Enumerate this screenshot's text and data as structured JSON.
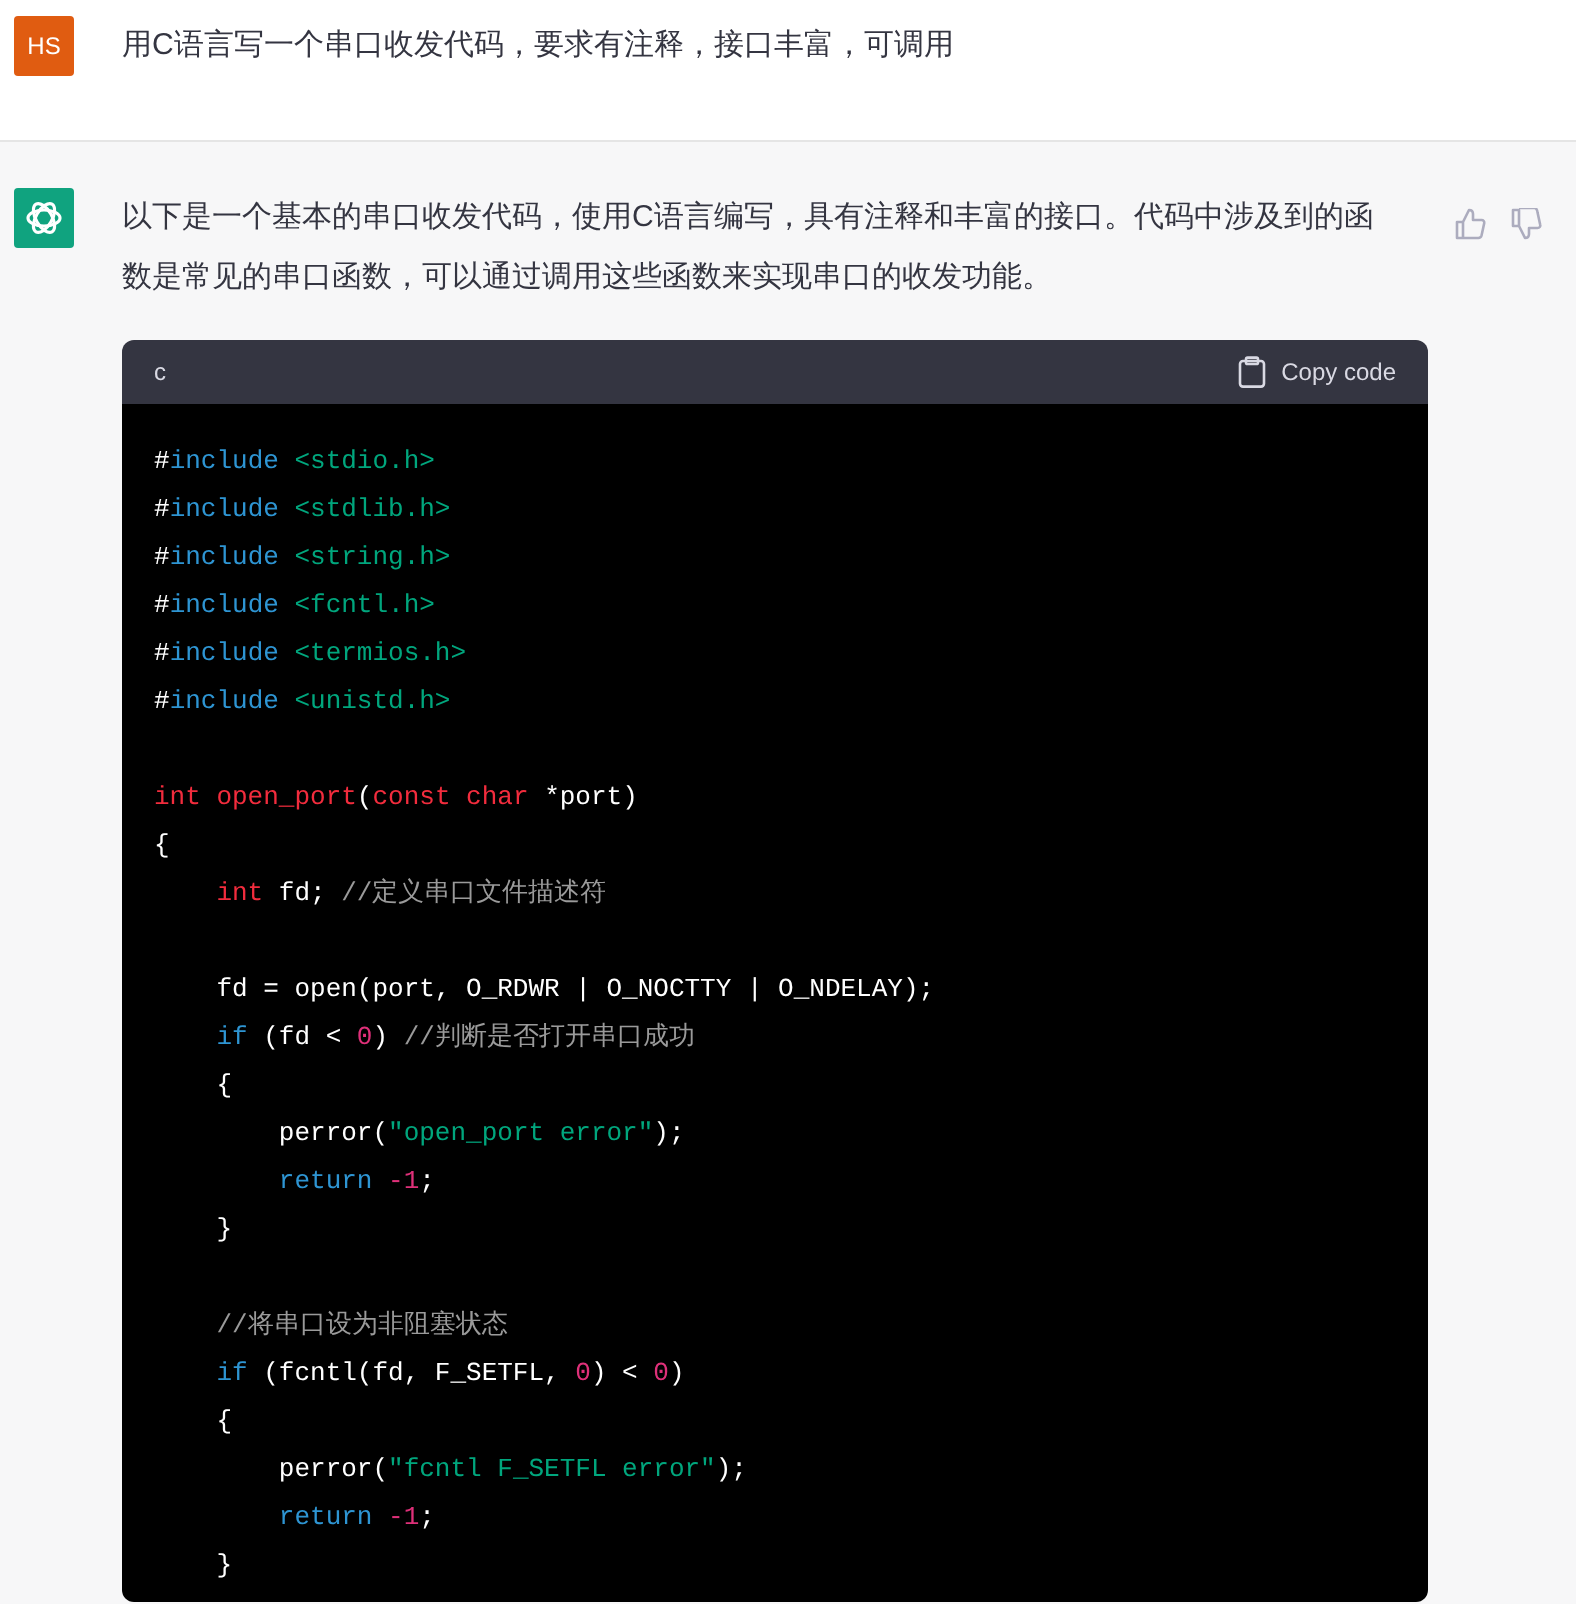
{
  "user_message": {
    "avatar": "HS",
    "text": "用C语言写一个串口收发代码，要求有注释，接口丰富，可调用"
  },
  "assistant_message": {
    "text": "以下是一个基本的串口收发代码，使用C语言编写，具有注释和丰富的接口。代码中涉及到的函数是常见的串口函数，可以通过调用这些函数来实现串口的收发功能。",
    "code_block": {
      "language": "c",
      "copy_label": "Copy code",
      "lines": [
        {
          "kind": "code",
          "tokens": [
            {
              "kind": "plain",
              "text": "#"
            },
            {
              "kind": "keyword",
              "text": "include"
            },
            {
              "kind": "string",
              "text": " <stdio.h>"
            }
          ]
        },
        {
          "kind": "code",
          "tokens": [
            {
              "kind": "plain",
              "text": "#"
            },
            {
              "kind": "keyword",
              "text": "include"
            },
            {
              "kind": "string",
              "text": " <stdlib.h>"
            }
          ]
        },
        {
          "kind": "code",
          "tokens": [
            {
              "kind": "plain",
              "text": "#"
            },
            {
              "kind": "keyword",
              "text": "include"
            },
            {
              "kind": "string",
              "text": " <string.h>"
            }
          ]
        },
        {
          "kind": "code",
          "tokens": [
            {
              "kind": "plain",
              "text": "#"
            },
            {
              "kind": "keyword",
              "text": "include"
            },
            {
              "kind": "string",
              "text": " <fcntl.h>"
            }
          ]
        },
        {
          "kind": "code",
          "tokens": [
            {
              "kind": "plain",
              "text": "#"
            },
            {
              "kind": "keyword",
              "text": "include"
            },
            {
              "kind": "string",
              "text": " <termios.h>"
            }
          ]
        },
        {
          "kind": "code",
          "tokens": [
            {
              "kind": "plain",
              "text": "#"
            },
            {
              "kind": "keyword",
              "text": "include"
            },
            {
              "kind": "string",
              "text": " <unistd.h>"
            }
          ]
        },
        {
          "kind": "blank"
        },
        {
          "kind": "code",
          "tokens": [
            {
              "kind": "type",
              "text": "int"
            },
            {
              "kind": "type",
              "text": " open_port"
            },
            {
              "kind": "plain",
              "text": "("
            },
            {
              "kind": "type",
              "text": "const"
            },
            {
              "kind": "type",
              "text": " char"
            },
            {
              "kind": "plain",
              "text": " *port)"
            }
          ]
        },
        {
          "kind": "code",
          "tokens": [
            {
              "kind": "plain",
              "text": "{"
            }
          ]
        },
        {
          "kind": "code",
          "tokens": [
            {
              "kind": "type",
              "text": "    int"
            },
            {
              "kind": "plain",
              "text": " fd; "
            },
            {
              "kind": "comment",
              "text": "//定义串口文件描述符"
            }
          ]
        },
        {
          "kind": "blank"
        },
        {
          "kind": "code",
          "tokens": [
            {
              "kind": "plain",
              "text": "    fd = open(port, O_RDWR | O_NOCTTY | O_NDELAY);"
            }
          ]
        },
        {
          "kind": "code",
          "tokens": [
            {
              "kind": "keyword",
              "text": "    if"
            },
            {
              "kind": "plain",
              "text": " (fd < "
            },
            {
              "kind": "number",
              "text": "0"
            },
            {
              "kind": "plain",
              "text": ") "
            },
            {
              "kind": "comment",
              "text": "//判断是否打开串口成功"
            }
          ]
        },
        {
          "kind": "code",
          "tokens": [
            {
              "kind": "plain",
              "text": "    {"
            }
          ]
        },
        {
          "kind": "code",
          "tokens": [
            {
              "kind": "plain",
              "text": "        perror("
            },
            {
              "kind": "string",
              "text": "\"open_port error\""
            },
            {
              "kind": "plain",
              "text": ");"
            }
          ]
        },
        {
          "kind": "code",
          "tokens": [
            {
              "kind": "keyword",
              "text": "        return"
            },
            {
              "kind": "number",
              "text": " -1"
            },
            {
              "kind": "plain",
              "text": ";"
            }
          ]
        },
        {
          "kind": "code",
          "tokens": [
            {
              "kind": "plain",
              "text": "    }"
            }
          ]
        },
        {
          "kind": "blank"
        },
        {
          "kind": "code",
          "tokens": [
            {
              "kind": "comment",
              "text": "    //将串口设为非阻塞状态"
            }
          ]
        },
        {
          "kind": "code",
          "tokens": [
            {
              "kind": "keyword",
              "text": "    if"
            },
            {
              "kind": "plain",
              "text": " (fcntl(fd, F_SETFL, "
            },
            {
              "kind": "number",
              "text": "0"
            },
            {
              "kind": "plain",
              "text": ") < "
            },
            {
              "kind": "number",
              "text": "0"
            },
            {
              "kind": "plain",
              "text": ")"
            }
          ]
        },
        {
          "kind": "code",
          "tokens": [
            {
              "kind": "plain",
              "text": "    {"
            }
          ]
        },
        {
          "kind": "code",
          "tokens": [
            {
              "kind": "plain",
              "text": "        perror("
            },
            {
              "kind": "string",
              "text": "\"fcntl F_SETFL error\""
            },
            {
              "kind": "plain",
              "text": ");"
            }
          ]
        },
        {
          "kind": "code",
          "tokens": [
            {
              "kind": "keyword",
              "text": "        return"
            },
            {
              "kind": "number",
              "text": " -1"
            },
            {
              "kind": "plain",
              "text": ";"
            }
          ]
        },
        {
          "kind": "code",
          "tokens": [
            {
              "kind": "plain",
              "text": "    }"
            }
          ]
        }
      ]
    }
  }
}
